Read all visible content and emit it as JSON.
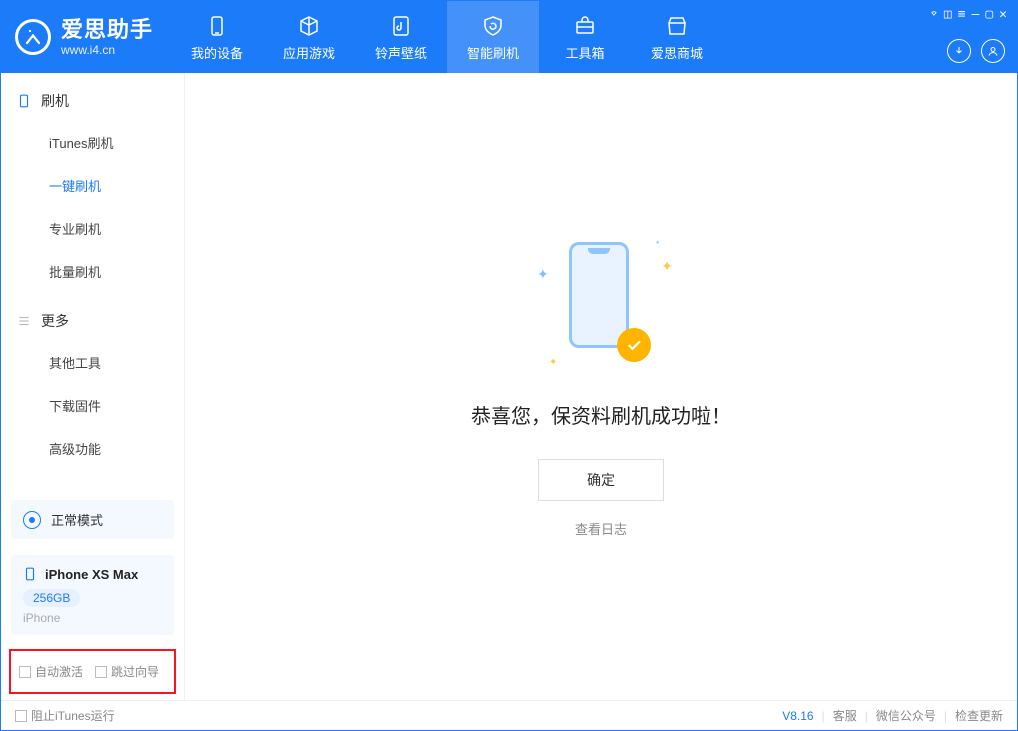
{
  "app": {
    "name": "爱思助手",
    "url": "www.i4.cn"
  },
  "nav": [
    {
      "id": "device",
      "label": "我的设备"
    },
    {
      "id": "apps",
      "label": "应用游戏"
    },
    {
      "id": "ring",
      "label": "铃声壁纸"
    },
    {
      "id": "flash",
      "label": "智能刷机"
    },
    {
      "id": "tools",
      "label": "工具箱"
    },
    {
      "id": "store",
      "label": "爱思商城"
    }
  ],
  "sidebar": {
    "flash_title": "刷机",
    "items_flash": [
      "iTunes刷机",
      "一键刷机",
      "专业刷机",
      "批量刷机"
    ],
    "more_title": "更多",
    "items_more": [
      "其他工具",
      "下载固件",
      "高级功能"
    ]
  },
  "mode": {
    "label": "正常模式"
  },
  "device": {
    "name": "iPhone XS Max",
    "storage": "256GB",
    "type": "iPhone"
  },
  "checks": {
    "auto_activate": "自动激活",
    "skip_guide": "跳过向导"
  },
  "main": {
    "success": "恭喜您，保资料刷机成功啦！",
    "ok": "确定",
    "view_log": "查看日志"
  },
  "footer": {
    "block_itunes": "阻止iTunes运行",
    "version": "V8.16",
    "support": "客服",
    "wechat": "微信公众号",
    "update": "检查更新"
  }
}
